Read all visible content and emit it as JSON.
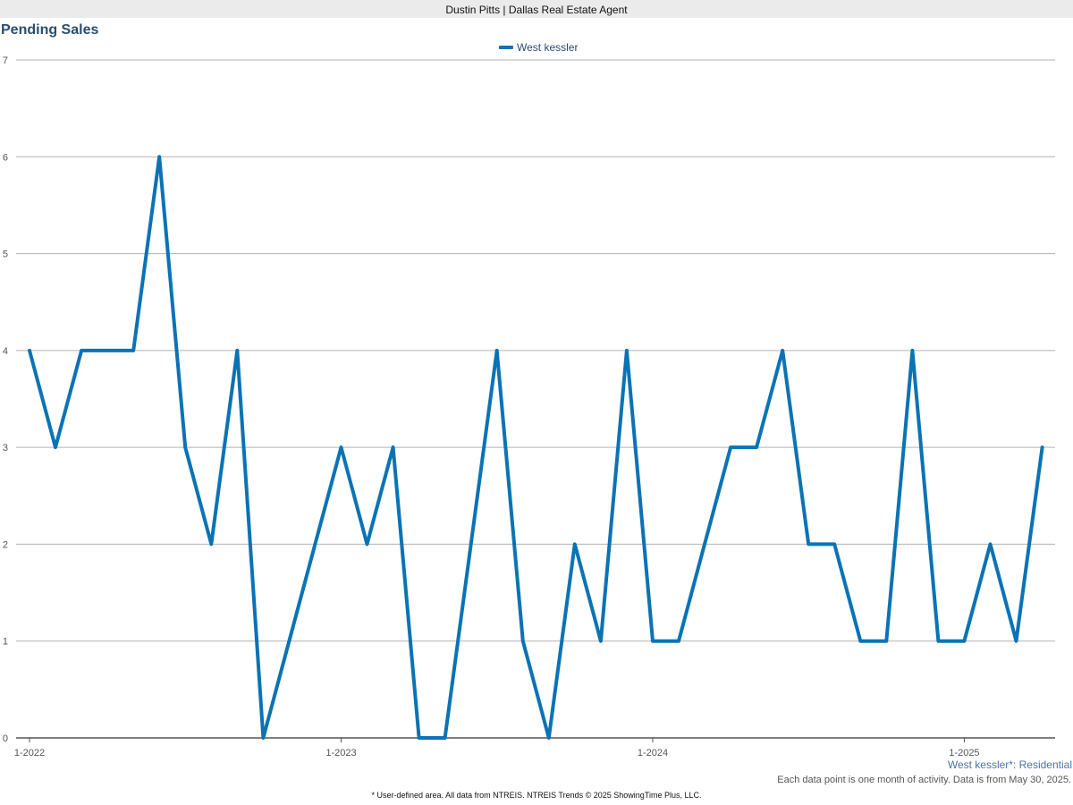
{
  "header": {
    "text": "Dustin Pitts | Dallas Real Estate Agent"
  },
  "area_label": "West kessler*: Residential",
  "data_note": "Each data point is one month of activity. Data is from May 30, 2025.",
  "footer": "* User-defined area. All data from NTREIS. NTREIS Trends © 2025 ShowingTime Plus, LLC.",
  "chart_data": {
    "type": "line",
    "title": "Pending Sales",
    "xlabel": "",
    "ylabel": "",
    "ylim": [
      0,
      7
    ],
    "yticks": [
      0,
      1,
      2,
      3,
      4,
      5,
      6,
      7
    ],
    "grid": true,
    "legend_position": "top-center",
    "x": [
      "1-2022",
      "2-2022",
      "3-2022",
      "4-2022",
      "5-2022",
      "6-2022",
      "7-2022",
      "8-2022",
      "9-2022",
      "10-2022",
      "11-2022",
      "12-2022",
      "1-2023",
      "2-2023",
      "3-2023",
      "4-2023",
      "5-2023",
      "6-2023",
      "7-2023",
      "8-2023",
      "9-2023",
      "10-2023",
      "11-2023",
      "12-2023",
      "1-2024",
      "2-2024",
      "3-2024",
      "4-2024",
      "5-2024",
      "6-2024",
      "7-2024",
      "8-2024",
      "9-2024",
      "10-2024",
      "11-2024",
      "12-2024",
      "1-2025",
      "2-2025",
      "3-2025",
      "4-2025"
    ],
    "x_tick_labels": [
      "1-2022",
      "1-2023",
      "1-2024",
      "1-2025"
    ],
    "series": [
      {
        "name": "West kessler",
        "color": "#0a73b5",
        "values": [
          4,
          3,
          4,
          4,
          4,
          6,
          3,
          2,
          4,
          0,
          1,
          2,
          3,
          2,
          3,
          0,
          0,
          2,
          4,
          1,
          0,
          2,
          1,
          4,
          1,
          1,
          2,
          3,
          3,
          4,
          2,
          2,
          1,
          1,
          4,
          1,
          1,
          2,
          1,
          3
        ]
      }
    ]
  }
}
